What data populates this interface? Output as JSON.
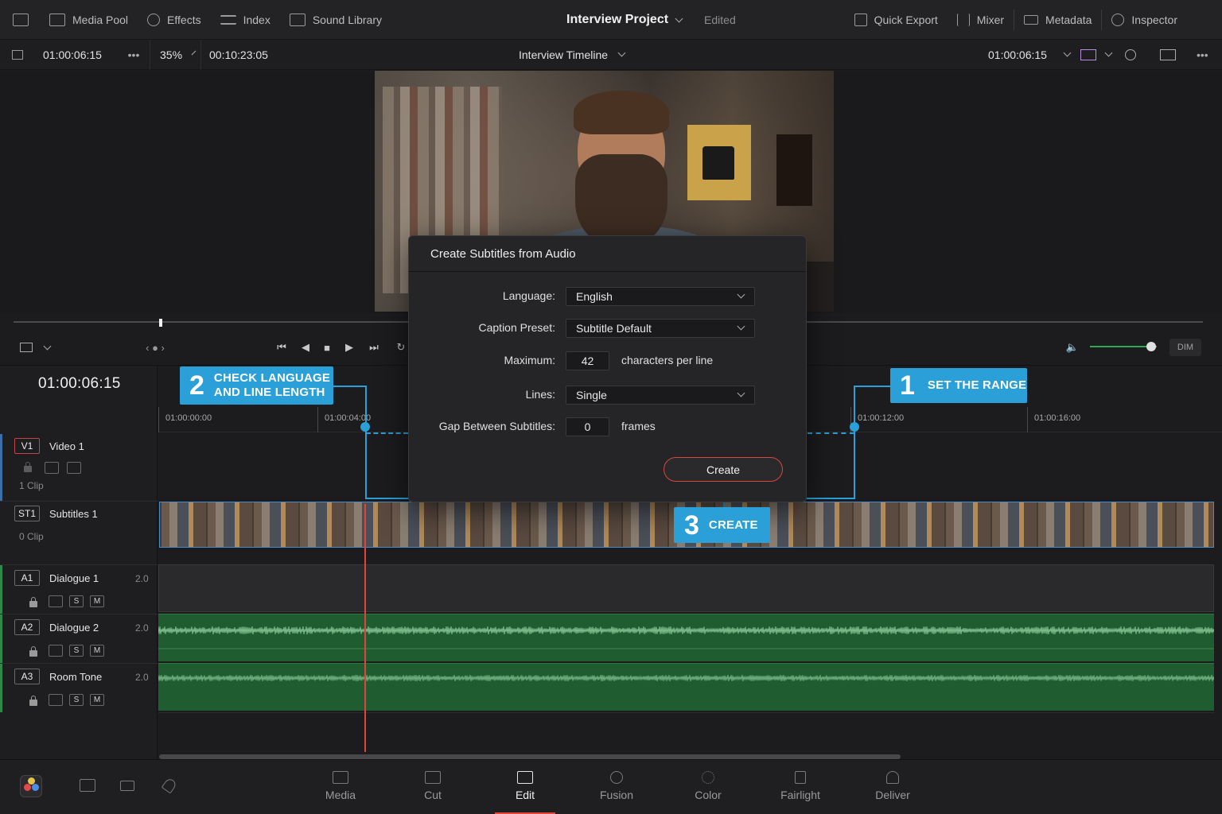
{
  "toolbar": {
    "media_pool": "Media Pool",
    "effects": "Effects",
    "index": "Index",
    "sound_library": "Sound Library",
    "project_title": "Interview Project",
    "project_status": "Edited",
    "quick_export": "Quick Export",
    "mixer": "Mixer",
    "metadata": "Metadata",
    "inspector": "Inspector"
  },
  "viewer_bar": {
    "source_timecode": "01:00:06:15",
    "zoom": "35%",
    "duration": "00:10:23:05",
    "timeline_name": "Interview Timeline",
    "record_timecode": "01:00:06:15"
  },
  "transport": {
    "dim_label": "DIM",
    "volume_level": 0.92
  },
  "timeline": {
    "current_timecode": "01:00:06:15",
    "ruler": [
      "01:00:00:00",
      "01:00:04:00",
      "01:00:12:00",
      "01:00:16:00"
    ],
    "tracks": {
      "v1": {
        "tag": "V1",
        "name": "Video 1",
        "clips": "1 Clip"
      },
      "st1": {
        "tag": "ST1",
        "name": "Subtitles 1",
        "clips": "0 Clip"
      },
      "a1": {
        "tag": "A1",
        "name": "Dialogue 1",
        "channels": "2.0"
      },
      "a2": {
        "tag": "A2",
        "name": "Dialogue 2",
        "channels": "2.0"
      },
      "a3": {
        "tag": "A3",
        "name": "Room Tone",
        "channels": "2.0"
      }
    },
    "solo_label": "S",
    "mute_label": "M"
  },
  "dialog": {
    "title": "Create Subtitles from Audio",
    "language_label": "Language:",
    "language_value": "English",
    "preset_label": "Caption Preset:",
    "preset_value": "Subtitle Default",
    "maximum_label": "Maximum:",
    "maximum_value": "42",
    "maximum_unit": "characters per line",
    "lines_label": "Lines:",
    "lines_value": "Single",
    "gap_label": "Gap Between Subtitles:",
    "gap_value": "0",
    "gap_unit": "frames",
    "create_label": "Create"
  },
  "callouts": {
    "c1": {
      "num": "1",
      "text": "SET THE RANGE"
    },
    "c2": {
      "num": "2",
      "line1": "CHECK LANGUAGE",
      "line2": "AND LINE LENGTH"
    },
    "c3": {
      "num": "3",
      "text": "CREATE"
    }
  },
  "pages": {
    "media": "Media",
    "cut": "Cut",
    "edit": "Edit",
    "fusion": "Fusion",
    "color": "Color",
    "fairlight": "Fairlight",
    "deliver": "Deliver"
  },
  "colors": {
    "accent_blue": "#2a9fd8",
    "playhead_red": "#e0443a",
    "audio_green": "#1f5c2f"
  }
}
